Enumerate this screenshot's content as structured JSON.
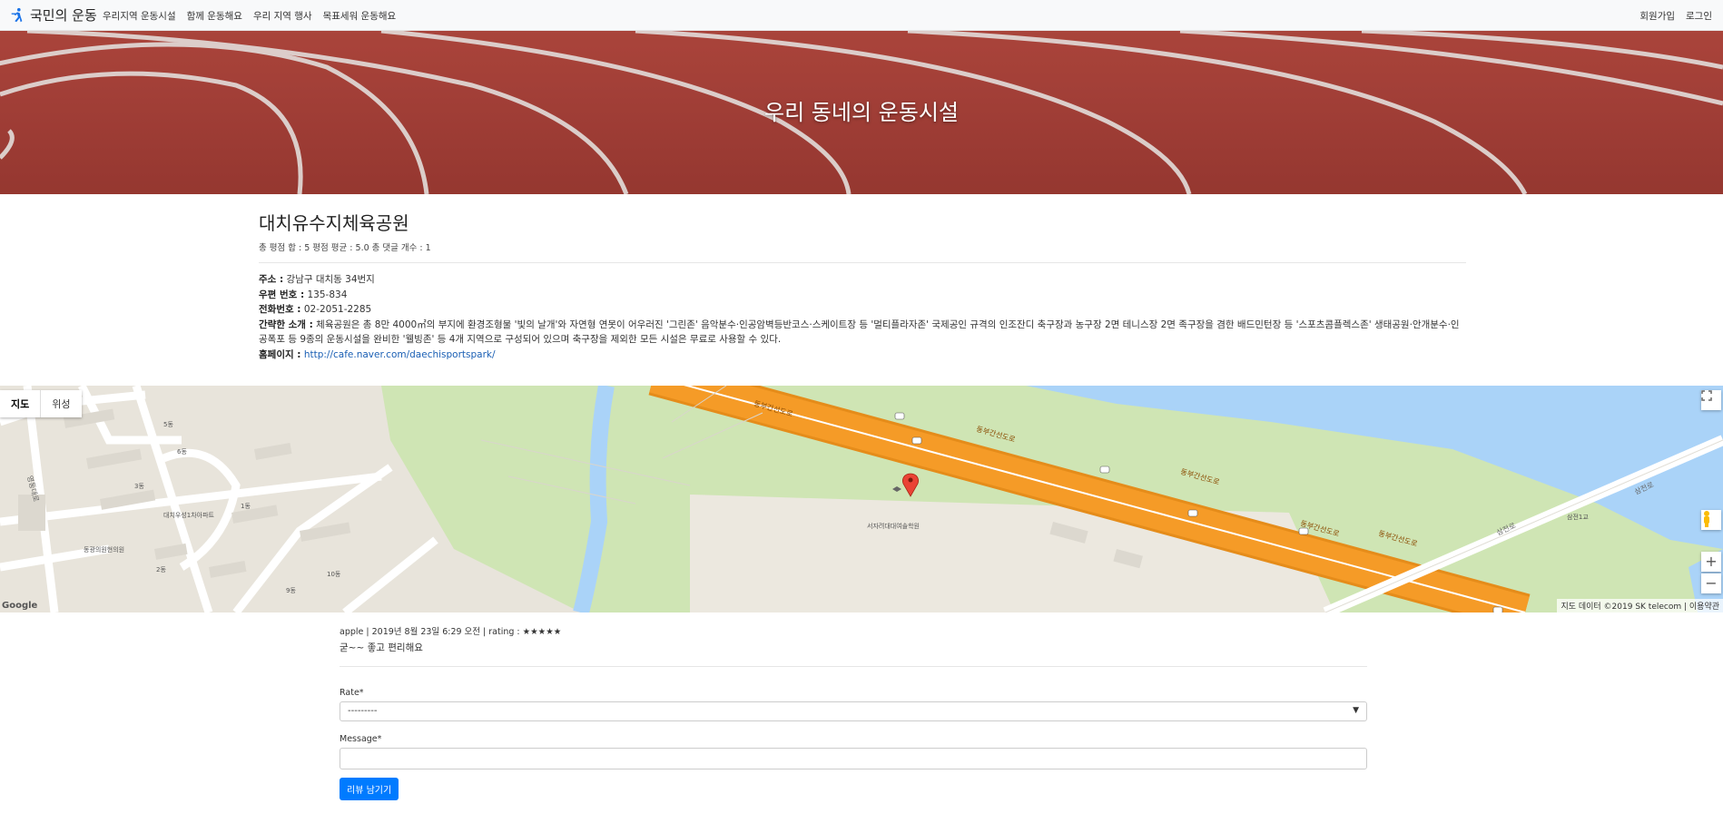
{
  "nav": {
    "brand": "국민의 운동",
    "links": [
      "우리지역 운동시설",
      "함께 운동해요",
      "우리 지역 행사",
      "목표세워 운동해요"
    ],
    "right": [
      "회원가입",
      "로그인"
    ]
  },
  "hero": {
    "title": "우리 동네의 운동시설"
  },
  "facility": {
    "name": "대치유수지체육공원",
    "stats": "총 평점 합 : 5 평점 평균 : 5.0 총 댓글 개수 : 1",
    "address_label": "주소 :",
    "address": "강남구 대치동 34번지",
    "zip_label": "우편 번호 :",
    "zip": "135-834",
    "phone_label": "전화번호 :",
    "phone": "02-2051-2285",
    "intro_label": "간략한 소개 :",
    "intro": "체육공원은 총 8만 4000㎡의 부지에 환경조형물 '빛의 날개'와 자연형 연못이 어우러진 '그린존' 음악분수·인공암벽등반코스·스케이트장 등 '멀티플라자존' 국제공인 규격의 인조잔디 축구장과 농구장 2면 테니스장 2면 족구장을 겸한 배드민턴장 등 '스포츠콤플렉스존' 생태공원·안개분수·인공폭포 등 9종의 운동시설을 완비한 '웰빙존' 등 4개 지역으로 구성되어 있으며 축구장을 제외한 모든 시설은 무료로 사용할 수 있다.",
    "homepage_label": "홈페이지 :",
    "homepage": "http://cafe.naver.com/daechisportspark/"
  },
  "map": {
    "type_map": "지도",
    "type_satellite": "위성",
    "attribution": "지도 데이터 ©2019 SK telecom | 이용약관",
    "google": "Google",
    "zoom_in": "+",
    "zoom_out": "−",
    "labels": {
      "road1": "동부간선도로",
      "road2": "동부간선도로",
      "road3": "동부간선도로",
      "road4": "동부간선도로",
      "road5": "동부간선도로",
      "samjeon": "삼전로",
      "samjeon2": "삼전로",
      "school": "서자려대대여솔학원",
      "apt": "대치우성1차아파트",
      "hospital": "동광의원현의원",
      "gangnam": "영동대로"
    }
  },
  "review": {
    "meta": "apple | 2019년 8월 23일 6:29 오전 | rating : ★★★★★",
    "message": "굳~~ 좋고 편리해요"
  },
  "form": {
    "rate_label": "Rate*",
    "rate_value": "---------",
    "message_label": "Message*",
    "message_value": "",
    "submit": "리뷰 남기기"
  },
  "colors": {
    "primary": "#007bff",
    "track": "#a8433b",
    "highway": "#f59b27",
    "water": "#aad3f8",
    "park": "#cfe5b4"
  }
}
